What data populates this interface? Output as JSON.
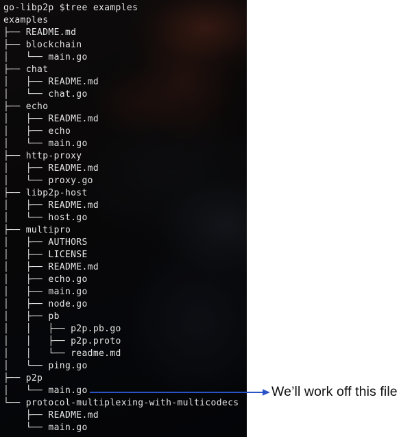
{
  "terminal": {
    "prompt_line": "go-libp2p $tree examples",
    "lines": [
      "go-libp2p $tree examples",
      "examples",
      "├── README.md",
      "├── blockchain",
      "│   └── main.go",
      "├── chat",
      "│   ├── README.md",
      "│   └── chat.go",
      "├── echo",
      "│   ├── README.md",
      "│   ├── echo",
      "│   └── main.go",
      "├── http-proxy",
      "│   ├── README.md",
      "│   └── proxy.go",
      "├── libp2p-host",
      "│   ├── README.md",
      "│   └── host.go",
      "├── multipro",
      "│   ├── AUTHORS",
      "│   ├── LICENSE",
      "│   ├── README.md",
      "│   ├── echo.go",
      "│   ├── main.go",
      "│   ├── node.go",
      "│   ├── pb",
      "│   │   ├── p2p.pb.go",
      "│   │   ├── p2p.proto",
      "│   │   └── readme.md",
      "│   └── ping.go",
      "├── p2p",
      "│   └── main.go",
      "└── protocol-multiplexing-with-multicodecs",
      "    ├── README.md",
      "    └── main.go"
    ],
    "command": "tree examples",
    "root_directory": "examples",
    "working_directory": "go-libp2p",
    "text_color": "#e8e8e8",
    "background_color": "#0a0706"
  },
  "annotation": {
    "label": "We’ll work off this file",
    "arrow_color": "#2b53c8",
    "points_at": "p2p/main.go"
  }
}
